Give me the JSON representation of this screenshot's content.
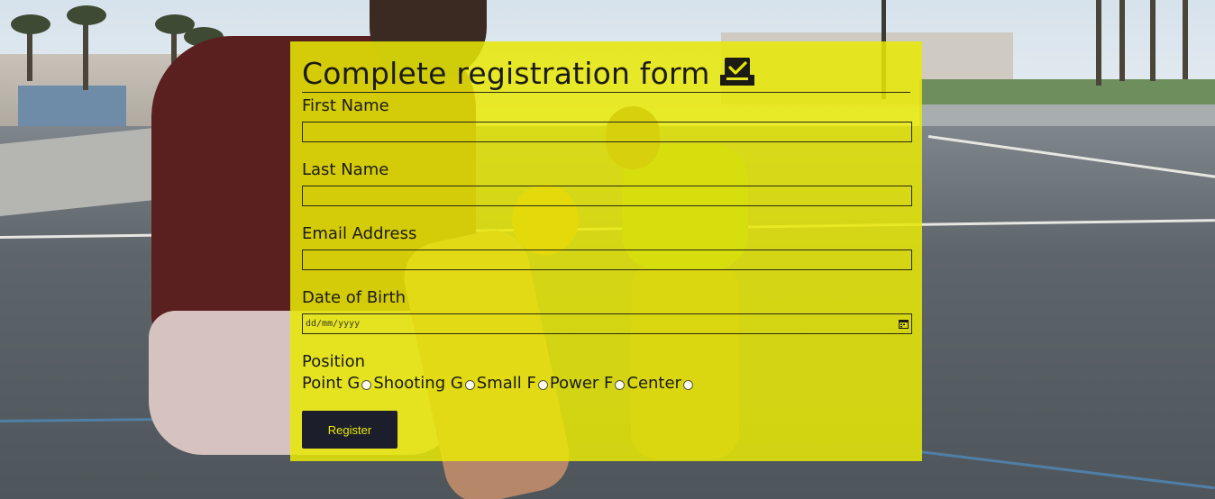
{
  "form": {
    "title": "Complete registration form",
    "title_icon": "checkbox-tray-icon",
    "fields": {
      "first_name": {
        "label": "First Name",
        "value": ""
      },
      "last_name": {
        "label": "Last Name",
        "value": ""
      },
      "email": {
        "label": "Email Address",
        "value": ""
      },
      "dob": {
        "label": "Date of Birth",
        "placeholder": "dd/mm/yyyy",
        "icon": "calendar-icon"
      }
    },
    "position": {
      "label": "Position",
      "options": [
        "Point G",
        "Shooting G",
        "Small F",
        "Power F",
        "Center"
      ],
      "selected": null
    },
    "register_label": "Register"
  },
  "colors": {
    "panel": "#e8e806",
    "button_bg": "#1c1f2b",
    "button_text": "#e8e806"
  }
}
